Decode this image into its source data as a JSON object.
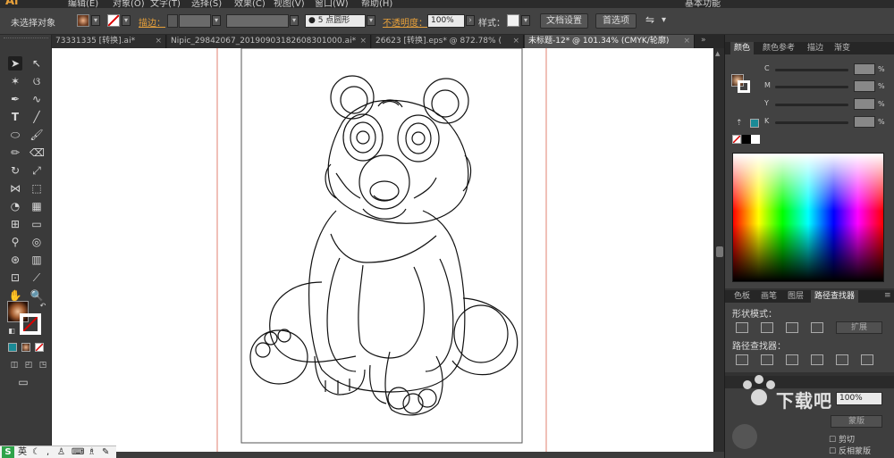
{
  "menubar": {
    "logo": "Ai",
    "items": [
      "编辑(E)",
      "对象(O)",
      "文字(T)",
      "选择(S)",
      "效果(C)",
      "视图(V)",
      "窗口(W)",
      "帮助(H)"
    ],
    "right": "基本功能"
  },
  "control": {
    "selection": "未选择对象",
    "stroke_label": "描边：",
    "brush_label": "5 点圆形",
    "opacity_label": "不透明度：",
    "opacity_value": "100%",
    "style_label": "样式：",
    "doc_setup": "文档设置",
    "prefs": "首选项"
  },
  "tabs": [
    {
      "label": "73331335 [转换].ai*",
      "close": "×"
    },
    {
      "label": "Nipic_29842067_20190903182608301000.ai*",
      "close": "×"
    },
    {
      "label": "26623 [转换].eps* @ 872.78% (",
      "close": "×"
    },
    {
      "label": "未标题-12* @ 101.34% (CMYK/轮廓)",
      "close": "×"
    }
  ],
  "color_panel": {
    "tabs": [
      "颜色",
      "颜色参考",
      "描边",
      "渐变"
    ],
    "channels": [
      {
        "name": "C",
        "unit": "%"
      },
      {
        "name": "M",
        "unit": "%"
      },
      {
        "name": "Y",
        "unit": "%"
      },
      {
        "name": "K",
        "unit": "%"
      }
    ]
  },
  "pathfinder_panel": {
    "tabs": [
      "色板",
      "画笔",
      "图层",
      "路径查找器"
    ],
    "shape_modes_label": "形状模式：",
    "expand_label": "扩展",
    "pathfinders_label": "路径查找器："
  },
  "bottom_right": {
    "opacity_value": "100%",
    "mask_label": "蒙版",
    "clip_label": "剪切",
    "invert_label": "反相蒙版"
  },
  "ime": {
    "brand": "S",
    "lang": "英"
  },
  "watermark": "下载吧",
  "colors": {
    "orange_link": "#e8a13a",
    "guide": "#e08070"
  }
}
